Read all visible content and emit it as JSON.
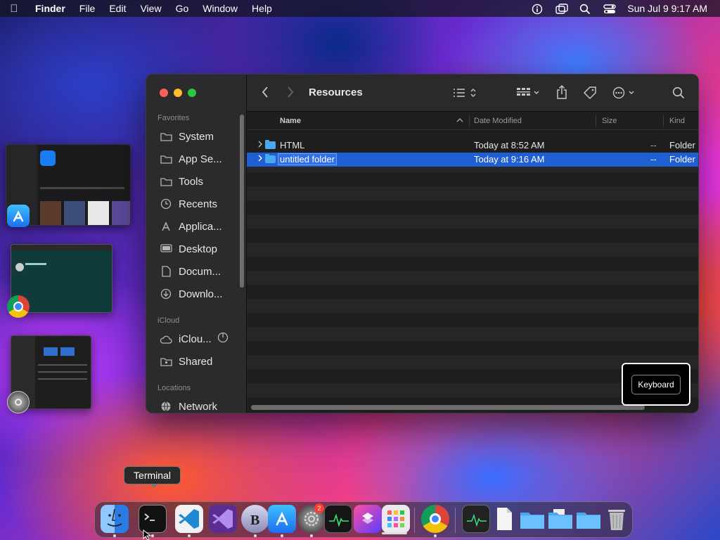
{
  "menubar": {
    "app": "Finder",
    "items": [
      "File",
      "Edit",
      "View",
      "Go",
      "Window",
      "Help"
    ],
    "clock": "Sun Jul 9  9:17 AM"
  },
  "window": {
    "title": "Resources",
    "sidebar": {
      "favorites_label": "Favorites",
      "favorites": [
        {
          "label": "System",
          "icon": "folder-icon"
        },
        {
          "label": "App Se...",
          "icon": "folder-icon"
        },
        {
          "label": "Tools",
          "icon": "folder-icon"
        },
        {
          "label": "Recents",
          "icon": "clock-icon"
        },
        {
          "label": "Applica...",
          "icon": "applications-icon"
        },
        {
          "label": "Desktop",
          "icon": "desktop-icon"
        },
        {
          "label": "Docum...",
          "icon": "document-icon"
        },
        {
          "label": "Downlo...",
          "icon": "download-icon"
        }
      ],
      "icloud_label": "iCloud",
      "icloud": [
        {
          "label": "iClou...",
          "icon": "cloud-icon"
        },
        {
          "label": "Shared",
          "icon": "shared-folder-icon"
        }
      ],
      "locations_label": "Locations",
      "locations": [
        {
          "label": "Network",
          "icon": "globe-icon"
        }
      ]
    },
    "columns": {
      "name": "Name",
      "date": "Date Modified",
      "size": "Size",
      "kind": "Kind"
    },
    "files": [
      {
        "name": "HTML",
        "date": "Today at 8:52 AM",
        "size": "--",
        "kind": "Folder",
        "selected": false
      },
      {
        "name": "untitled folder",
        "date": "Today at 9:16 AM",
        "size": "--",
        "kind": "Folder",
        "selected": true
      }
    ]
  },
  "keyboard_overlay": "Keyboard",
  "dock": {
    "tooltip": "Terminal",
    "apps": [
      "finder-icon",
      "terminal-icon",
      "vscode-icon",
      "visual-studio-icon",
      "bbedit-icon",
      "app-store-icon",
      "system-settings-icon",
      "activity-monitor-icon",
      "shortcuts-icon",
      "launchpad-icon",
      "chrome-icon",
      "activity-monitor-doc-icon",
      "document-icon",
      "folder-icon",
      "folder-icon",
      "folder-icon",
      "trash-icon"
    ],
    "settings_badge": "2"
  }
}
